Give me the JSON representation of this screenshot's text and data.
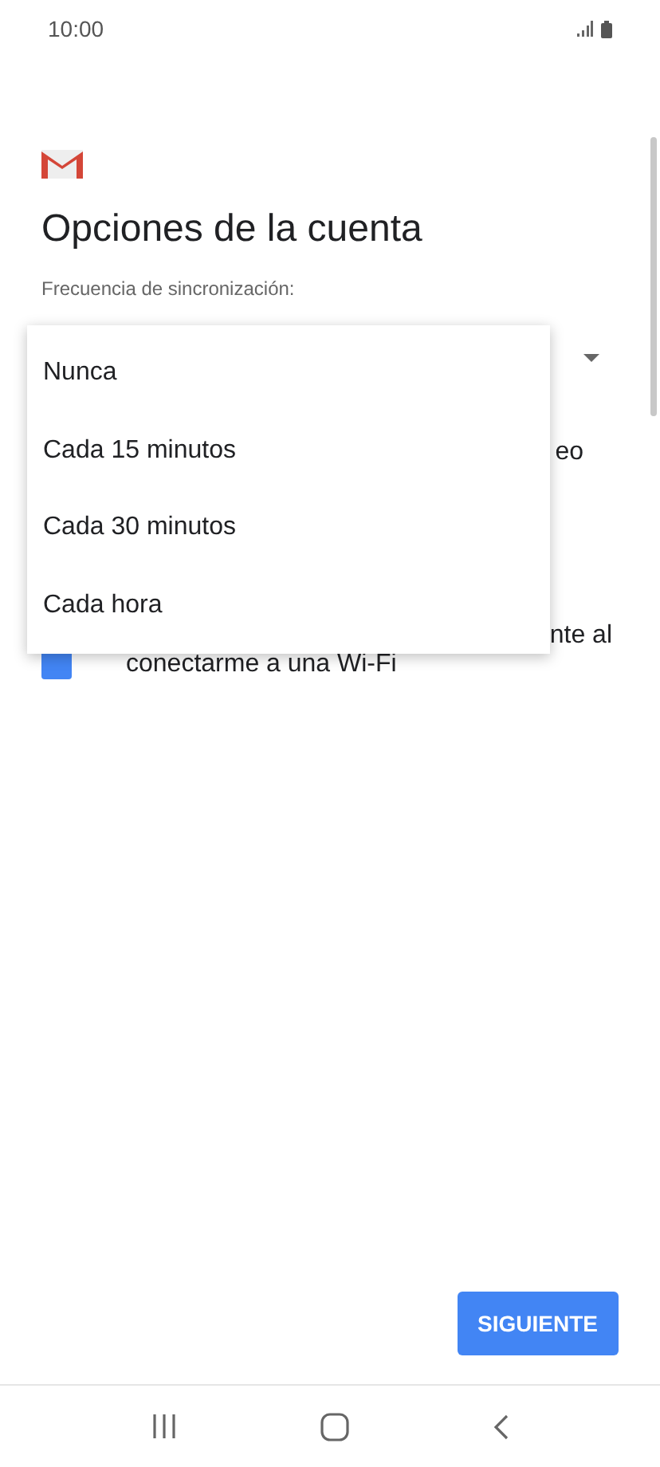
{
  "status_bar": {
    "time": "10:00"
  },
  "title": "Opciones de la cuenta",
  "sync": {
    "label": "Frecuencia de sincronización:"
  },
  "settings": [
    {
      "kind": "partial",
      "text": "eo"
    },
    {
      "kind": "checkbox",
      "text_end": "nte al",
      "text_second_line": "conectarme a una Wi-Fi",
      "checked": true
    }
  ],
  "menu": {
    "options": [
      {
        "label": "Nunca"
      },
      {
        "label": "Cada 15 minutos"
      },
      {
        "label": "Cada 30 minutos"
      },
      {
        "label": "Cada hora"
      }
    ]
  },
  "buttons": [
    {
      "label": "SIGUIENTE"
    }
  ]
}
